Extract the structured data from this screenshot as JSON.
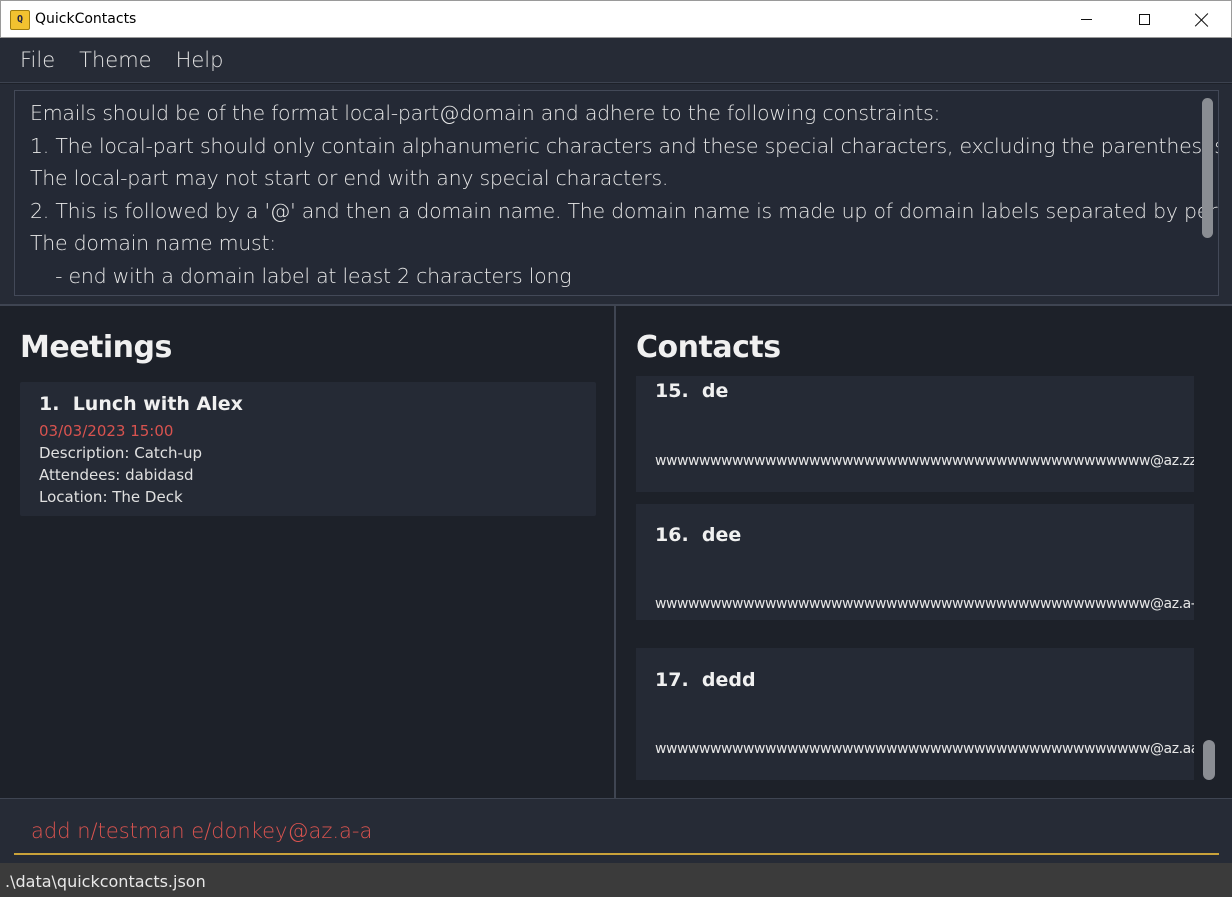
{
  "window": {
    "title": "QuickContacts",
    "icon": "app-logo-icon",
    "controls": [
      "minimize-icon",
      "maximize-icon",
      "close-icon"
    ]
  },
  "menu": {
    "items": [
      "File",
      "Theme",
      "Help"
    ]
  },
  "result": {
    "lines": [
      "Emails should be of the format local-part@domain and adhere to the following constraints:",
      "1. The local-part should only contain alphanumeric characters and these special characters, excluding the parentheses, (+_.-).",
      "The local-part may not start or end with any special characters.",
      "2. This is followed by a '@' and then a domain name. The domain name is made up of domain labels separated by periods.",
      "The domain name must:",
      "    - end with a domain label at least 2 characters long"
    ]
  },
  "meetings": {
    "title": "Meetings",
    "items": [
      {
        "index": "1.",
        "name": "Lunch with Alex",
        "datetime": "03/03/2023 15:00",
        "description": "Description: Catch-up",
        "attendees": "Attendees: dabidasd",
        "location": "Location: The Deck"
      }
    ]
  },
  "contacts": {
    "title": "Contacts",
    "items": [
      {
        "index": "15.",
        "name": "de",
        "email": "wwwwwwwwwwwwwwwwwwwwwwwwwwwwwwwwwwwwwwwwwwwww@az.zz"
      },
      {
        "index": "16.",
        "name": "dee",
        "email": "wwwwwwwwwwwwwwwwwwwwwwwwwwwwwwwwwwwwwwwwwwwww@az.a-aa"
      },
      {
        "index": "17.",
        "name": "dedd",
        "email": "wwwwwwwwwwwwwwwwwwwwwwwwwwwwwwwwwwwwwwwwwwwww@az.aa-a"
      }
    ]
  },
  "command": {
    "value": "add n/testman e/donkey@az.a-a",
    "text_color": "#d9534f"
  },
  "status": {
    "path": ".\\data\\quickcontacts.json"
  },
  "colors": {
    "background": "#1d2129",
    "panel": "#262b36",
    "card": "#252a35",
    "error_text": "#d9534f",
    "command_underline": "#c9a23a"
  }
}
